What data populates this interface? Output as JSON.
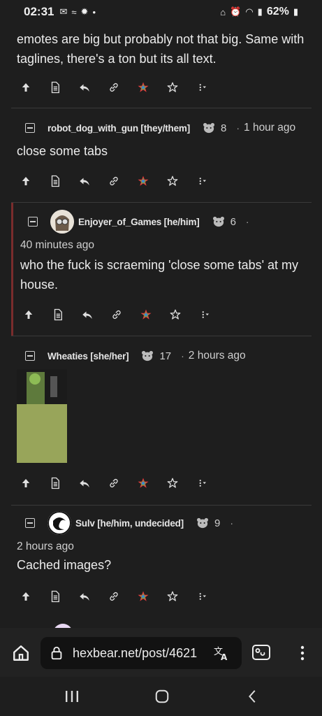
{
  "status": {
    "time": "02:31",
    "battery": "62%"
  },
  "top_comment": {
    "text": "emotes are big but probably not that big. Same with taglines, there's a ton but its all text."
  },
  "comments": [
    {
      "username": "robot_dog_with_gun [they/them]",
      "score": "8",
      "time": "1 hour ago",
      "text": "close some tabs"
    },
    {
      "username": "Enjoyer_of_Games [he/him]",
      "score": "6",
      "time": "40 minutes ago",
      "text": "who the fuck is scraeming 'close some tabs' at my house."
    },
    {
      "username": "Wheaties [she/her]",
      "score": "17",
      "time": "2 hours ago"
    },
    {
      "username": "Sulv [he/him, undecided]",
      "score": "9",
      "time": "2 hours ago",
      "text": "Cached images?"
    }
  ],
  "browser": {
    "url": "hexbear.net/post/4621"
  },
  "icons": [
    "upvote-icon",
    "source-icon",
    "reply-icon",
    "link-icon",
    "rainbow-star-icon",
    "save-star-icon",
    "more-icon",
    "home-icon",
    "lock-icon",
    "translate-icon",
    "reader-icon",
    "menu-icon"
  ]
}
